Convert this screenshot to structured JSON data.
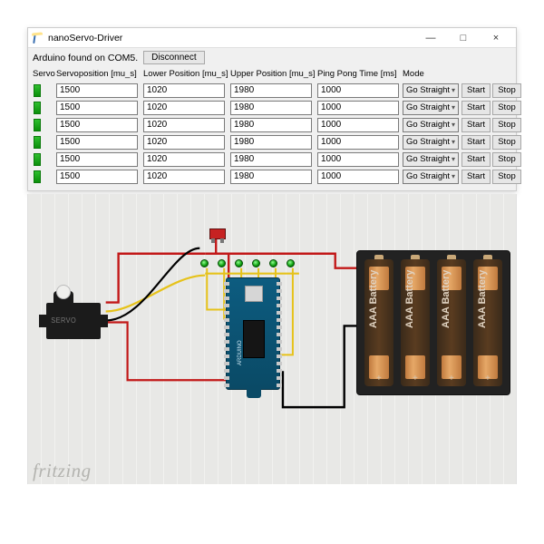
{
  "window": {
    "title": "nanoServo-Driver",
    "min": "—",
    "max": "□",
    "close": "×"
  },
  "toolbar": {
    "status": "Arduino found on COM5.",
    "disconnect": "Disconnect"
  },
  "columns": {
    "c0": "Servo",
    "c1": "Servoposition [mu_s]",
    "c2": "Lower Position [mu_s]",
    "c3": "Upper Position [mu_s]",
    "c4": "Ping Pong Time [ms]",
    "c5": "Mode",
    "c6": "",
    "c7": ""
  },
  "default_row": {
    "pos": "1500",
    "lower": "1020",
    "upper": "1980",
    "ping": "1000",
    "mode": "Go Straight",
    "start": "Start",
    "stop": "Stop"
  },
  "rows": [
    {
      "pos": "1500",
      "lower": "1020",
      "upper": "1980",
      "ping": "1000",
      "mode": "Go Straight"
    },
    {
      "pos": "1500",
      "lower": "1020",
      "upper": "1980",
      "ping": "1000",
      "mode": "Go Straight"
    },
    {
      "pos": "1500",
      "lower": "1020",
      "upper": "1980",
      "ping": "1000",
      "mode": "Go Straight"
    },
    {
      "pos": "1500",
      "lower": "1020",
      "upper": "1980",
      "ping": "1000",
      "mode": "Go Straight"
    },
    {
      "pos": "1500",
      "lower": "1020",
      "upper": "1980",
      "ping": "1000",
      "mode": "Go Straight"
    },
    {
      "pos": "1500",
      "lower": "1020",
      "upper": "1980",
      "ping": "1000",
      "mode": "Go Straight"
    }
  ],
  "battery": {
    "label": "AAA Battery"
  },
  "servo": {
    "label": "SERVO"
  },
  "watermark": "fritzing"
}
